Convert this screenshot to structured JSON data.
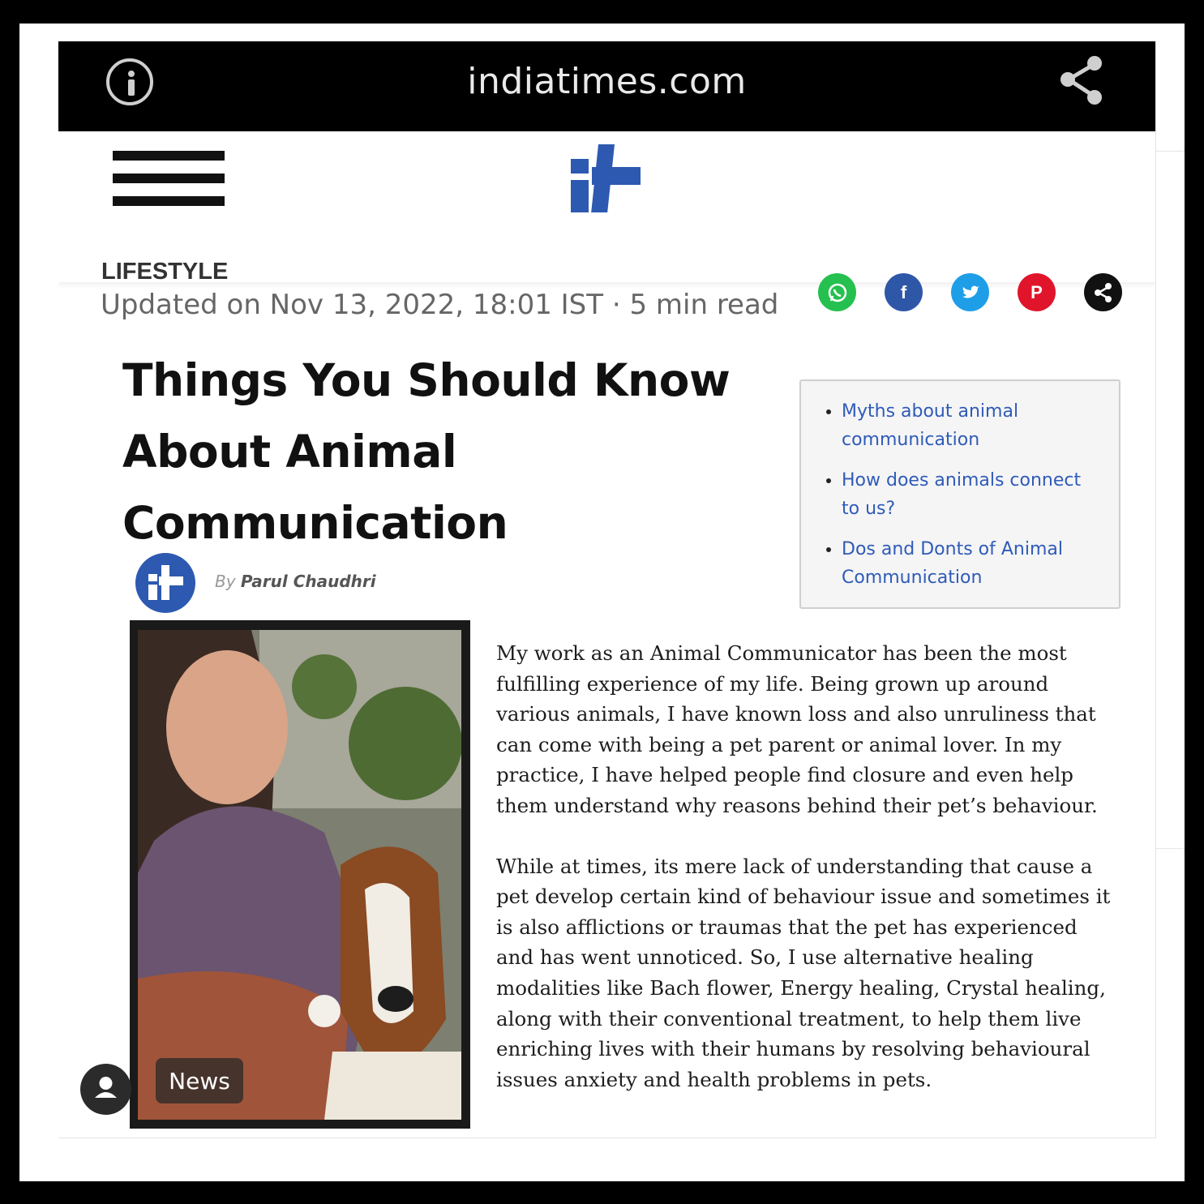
{
  "browser": {
    "url": "indiatimes.com",
    "icons": [
      "info-icon",
      "share-icon"
    ]
  },
  "site": {
    "menu_icon": "hamburger-icon",
    "logo": "indiatimes-logo",
    "brand_color": "#2d59b1"
  },
  "article": {
    "section": "LIFESTYLE",
    "updated": "Updated on Nov 13, 2022, 18:01 IST · 5 min read",
    "title": "Things You Should Know About Animal Communication",
    "byline_prefix": "By",
    "author": "Parul Chaudhri",
    "image_badge": "News",
    "paragraphs": [
      "My work as an Animal Communicator has been the most fulfilling experience of my life. Being grown up around various animals, I have known loss and also unruliness that can come with being a pet parent or animal lover. In my practice, I have helped people find closure and even help them understand why reasons behind their pet’s behaviour.",
      "While at times, its mere lack of understanding that cause a pet develop certain kind of behaviour issue  and sometimes it is also afflictions or traumas that the pet has experienced and has went unnoticed. So, I use alternative healing modalities like Bach flower, Energy healing, Crystal healing, along with their conventional treatment, to help them live enriching lives with their humans by resolving behavioural issues anxiety and health problems  in pets."
    ]
  },
  "social": [
    {
      "name": "whatsapp",
      "color": "#25c04f"
    },
    {
      "name": "facebook",
      "color": "#2f57a8"
    },
    {
      "name": "twitter",
      "color": "#1f9ee8"
    },
    {
      "name": "pinterest",
      "color": "#e0152b"
    },
    {
      "name": "share",
      "color": "#111111"
    }
  ],
  "toc": [
    "Myths about animal communication",
    "How does animals connect to us?",
    "Dos and Donts of Animal Communication"
  ]
}
